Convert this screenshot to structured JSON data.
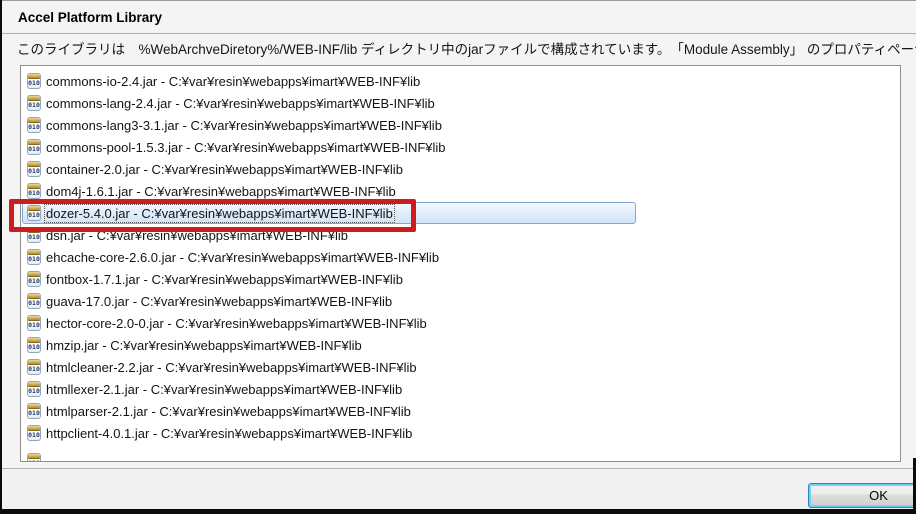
{
  "dialog": {
    "title": "Accel Platform Library",
    "description": "このライブラリは　%WebArchveDiretory%/WEB-INF/lib ディレクトリ中のjarファイルで構成されています。　「Module Assembly」 のプロパティページでWebア",
    "ok_label": "OK"
  },
  "list": {
    "jar_icon_glyph": "010",
    "selected_index": 6,
    "has_partial_row": true,
    "items": [
      "commons-io-2.4.jar - C:¥var¥resin¥webapps¥imart¥WEB-INF¥lib",
      "commons-lang-2.4.jar - C:¥var¥resin¥webapps¥imart¥WEB-INF¥lib",
      "commons-lang3-3.1.jar - C:¥var¥resin¥webapps¥imart¥WEB-INF¥lib",
      "commons-pool-1.5.3.jar - C:¥var¥resin¥webapps¥imart¥WEB-INF¥lib",
      "container-2.0.jar - C:¥var¥resin¥webapps¥imart¥WEB-INF¥lib",
      "dom4j-1.6.1.jar - C:¥var¥resin¥webapps¥imart¥WEB-INF¥lib",
      "dozer-5.4.0.jar - C:¥var¥resin¥webapps¥imart¥WEB-INF¥lib",
      "dsn.jar - C:¥var¥resin¥webapps¥imart¥WEB-INF¥lib",
      "ehcache-core-2.6.0.jar - C:¥var¥resin¥webapps¥imart¥WEB-INF¥lib",
      "fontbox-1.7.1.jar - C:¥var¥resin¥webapps¥imart¥WEB-INF¥lib",
      "guava-17.0.jar - C:¥var¥resin¥webapps¥imart¥WEB-INF¥lib",
      "hector-core-2.0-0.jar - C:¥var¥resin¥webapps¥imart¥WEB-INF¥lib",
      "hmzip.jar - C:¥var¥resin¥webapps¥imart¥WEB-INF¥lib",
      "htmlcleaner-2.2.jar - C:¥var¥resin¥webapps¥imart¥WEB-INF¥lib",
      "htmllexer-2.1.jar - C:¥var¥resin¥webapps¥imart¥WEB-INF¥lib",
      "htmlparser-2.1.jar - C:¥var¥resin¥webapps¥imart¥WEB-INF¥lib",
      "httpclient-4.0.1.jar - C:¥var¥resin¥webapps¥imart¥WEB-INF¥lib"
    ]
  },
  "annotation": {
    "red_box_color": "#ce1b1b"
  },
  "colors": {
    "selection_border": "#84a7d3",
    "selection_bg_top": "#f4f9fe",
    "selection_bg_bottom": "#d0e4f7",
    "button_focus_glow": "#6ed0f2"
  }
}
